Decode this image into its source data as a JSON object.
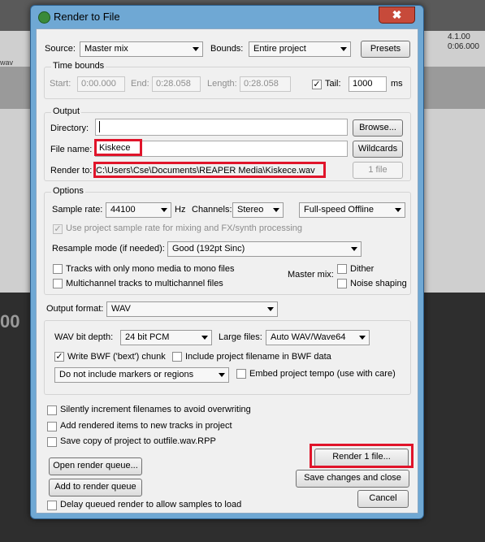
{
  "background": {
    "ruler_time": "4.1.00",
    "ruler_time2": "0:06.000",
    "big_time": "00",
    "track_label": "wav"
  },
  "dialog": {
    "title": "Render to File",
    "close_glyph": "✖"
  },
  "source": {
    "label": "Source:",
    "value": "Master mix"
  },
  "bounds": {
    "label": "Bounds:",
    "value": "Entire project"
  },
  "presets_label": "Presets",
  "time_bounds": {
    "title": "Time bounds",
    "start_label": "Start:",
    "start_value": "0:00.000",
    "end_label": "End:",
    "end_value": "0:28.058",
    "length_label": "Length:",
    "length_value": "0:28.058",
    "tail_label": "Tail:",
    "tail_value": "1000",
    "tail_unit": "ms"
  },
  "output": {
    "title": "Output",
    "directory_label": "Directory:",
    "directory_value": "",
    "browse_label": "Browse...",
    "filename_label": "File name:",
    "filename_value": "Kiskece",
    "wildcards_label": "Wildcards",
    "render_to_label": "Render to:",
    "render_to_value": "C:\\Users\\Cse\\Documents\\REAPER Media\\Kiskece.wav",
    "file_count_label": "1 file"
  },
  "options": {
    "title": "Options",
    "sample_rate_label": "Sample rate:",
    "sample_rate_value": "44100",
    "hz_label": "Hz",
    "channels_label": "Channels:",
    "channels_value": "Stereo",
    "speed_value": "Full-speed Offline",
    "use_project_rate": "Use project sample rate for mixing and FX/synth processing",
    "resample_label": "Resample mode (if needed):",
    "resample_value": "Good (192pt Sinc)",
    "mono_media": "Tracks with only mono media to mono files",
    "multichannel": "Multichannel tracks to multichannel files",
    "master_mix_label": "Master mix:",
    "dither": "Dither",
    "noise_shaping": "Noise shaping"
  },
  "format": {
    "label": "Output format:",
    "value": "WAV",
    "bit_depth_label": "WAV bit depth:",
    "bit_depth_value": "24 bit PCM",
    "large_files_label": "Large files:",
    "large_files_value": "Auto WAV/Wave64",
    "bwf_chunk": "Write BWF ('bext') chunk",
    "include_filename": "Include project filename in BWF data",
    "markers_value": "Do not include markers or regions",
    "embed_tempo": "Embed project tempo (use with care)"
  },
  "bottom": {
    "silently_increment": "Silently increment filenames to avoid overwriting",
    "add_to_tracks": "Add rendered items to new tracks in project",
    "save_copy": "Save copy of project to outfile.wav.RPP",
    "open_queue": "Open render queue...",
    "add_queue": "Add to render queue",
    "delay_queued": "Delay queued render to allow samples to load",
    "render_button": "Render 1 file...",
    "save_close": "Save changes and close",
    "cancel": "Cancel"
  },
  "checkmark": "✓",
  "colors": {
    "highlight": "#e0142a",
    "titlebar": "#6fa8d4"
  }
}
